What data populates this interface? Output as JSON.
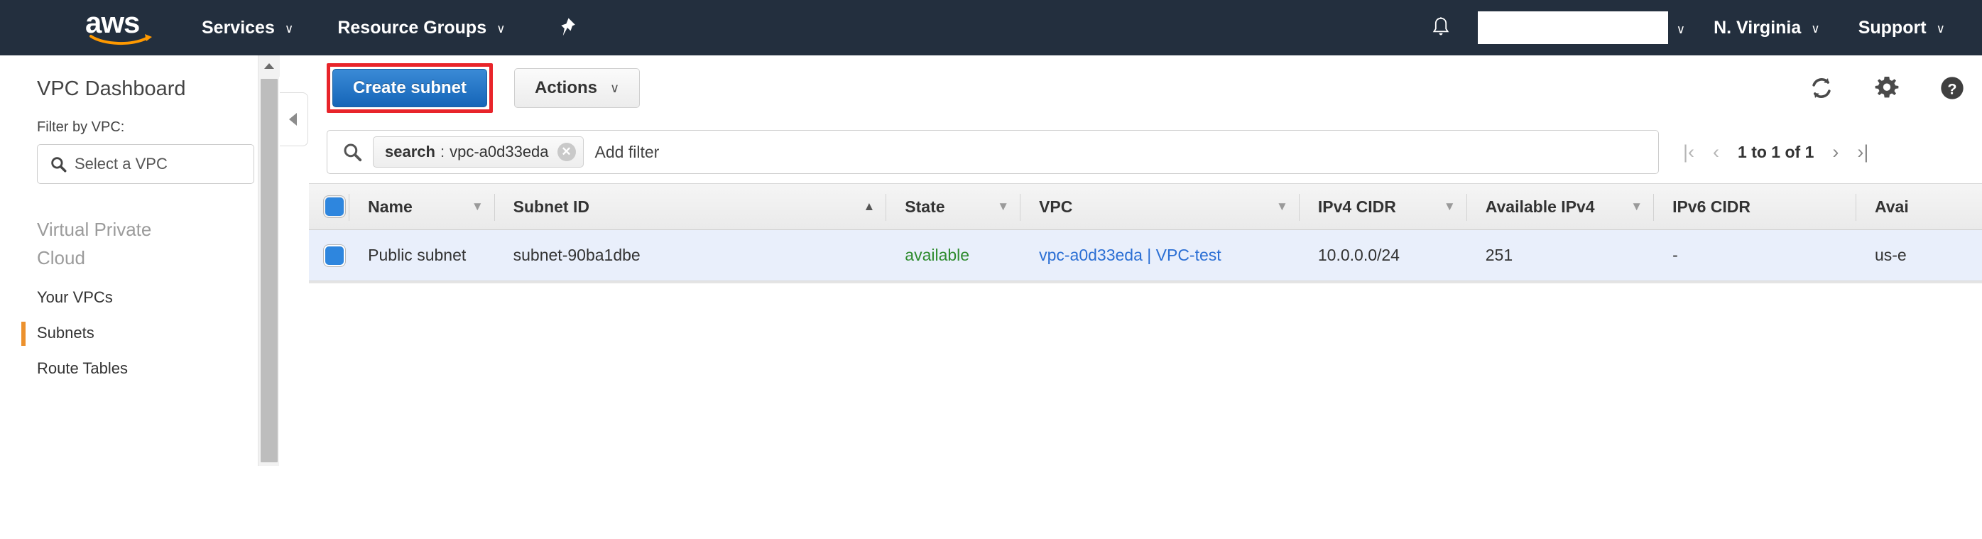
{
  "navbar": {
    "logo_alt": "aws",
    "services_label": "Services",
    "resource_groups_label": "Resource Groups",
    "pin_icon": "pushpin-icon",
    "bell_icon": "notifications-bell-icon",
    "account_label": "",
    "region_label": "N. Virginia",
    "support_label": "Support",
    "caret": "∨",
    "bg_color": "#232f3e"
  },
  "sidebar": {
    "title": "VPC Dashboard",
    "filter_label": "Filter by VPC:",
    "vpc_select_placeholder": "Select a VPC",
    "section_header": "Virtual Private Cloud",
    "items": [
      {
        "label": "Your VPCs",
        "active": false
      },
      {
        "label": "Subnets",
        "active": true
      },
      {
        "label": "Route Tables",
        "active": false
      }
    ],
    "active_accent": "#ec912d",
    "collapse_icon": "collapse-panel-left-arrow-icon",
    "scroll_up_icon": "scroll-up-arrow-icon"
  },
  "toolbar": {
    "create_label": "Create subnet",
    "actions_label": "Actions",
    "actions_caret": "∨",
    "highlight_color": "#e8242a",
    "primary_color": "#1565b8",
    "icons": [
      {
        "name": "refresh-icon"
      },
      {
        "name": "gear-icon"
      },
      {
        "name": "help-icon"
      }
    ]
  },
  "search": {
    "search_icon": "search-icon",
    "token_key": "search",
    "token_sep": ":",
    "token_value": "vpc-a0d33eda",
    "token_remove_icon": "remove-filter-x-icon",
    "placeholder": "Add filter"
  },
  "pagination": {
    "first_icon": "|‹",
    "prev_icon": "‹",
    "label": "1 to 1 of 1",
    "next_icon": "›",
    "last_icon": "›|"
  },
  "table": {
    "select_all_checked": true,
    "columns": [
      {
        "key": "name",
        "label": "Name",
        "sort": "desc",
        "sorted": false
      },
      {
        "key": "sid",
        "label": "Subnet ID",
        "sort": "asc",
        "sorted": true
      },
      {
        "key": "state",
        "label": "State",
        "sort": "desc",
        "sorted": false
      },
      {
        "key": "vpc",
        "label": "VPC",
        "sort": "desc",
        "sorted": false
      },
      {
        "key": "cidr",
        "label": "IPv4 CIDR",
        "sort": "desc",
        "sorted": false
      },
      {
        "key": "avail",
        "label": "Available IPv4",
        "sort": "desc",
        "sorted": false
      },
      {
        "key": "ipv6",
        "label": "IPv6 CIDR",
        "sort": "none",
        "sorted": false
      },
      {
        "key": "az",
        "label": "Avai",
        "sort": "none",
        "sorted": false
      }
    ],
    "rows": [
      {
        "selected": true,
        "name": "Public subnet",
        "sid": "subnet-90ba1dbe",
        "state": "available",
        "vpc": "vpc-a0d33eda | VPC-test",
        "cidr": "10.0.0.0/24",
        "avail": "251",
        "ipv6": "-",
        "az": "us-e"
      }
    ],
    "row_selected_bg": "#e9effb",
    "state_color": "#2e8b2e",
    "link_color": "#2b6fd4"
  }
}
